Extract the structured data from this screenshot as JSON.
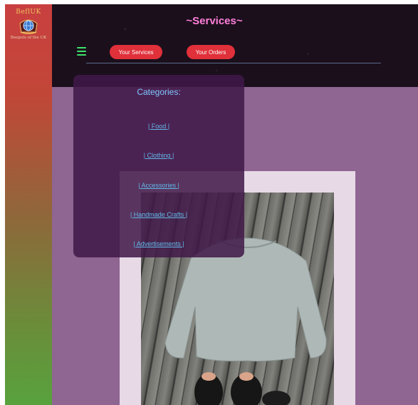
{
  "logo": {
    "title": "BeflUK",
    "subtitle": "Beepuls of the UK"
  },
  "header": {
    "title": "~Services~",
    "menu_icon": "hamburger-icon",
    "buttons": {
      "your_services": "Your Services",
      "your_orders": "Your Orders"
    }
  },
  "categories": {
    "heading": "Categories:",
    "items": [
      "| Food |",
      "| Clothing |",
      "| Accessories |",
      "| Handmade Crafts |",
      "| Advertisements |"
    ]
  },
  "colors": {
    "header_bg": "#1b0f1c",
    "title_pink": "#ff7fd9",
    "button_red": "#e0303a",
    "menu_green": "#3ee26a",
    "main_purple": "#8f6592",
    "panel_purple": "#401848",
    "link_blue": "#62b8e8"
  }
}
